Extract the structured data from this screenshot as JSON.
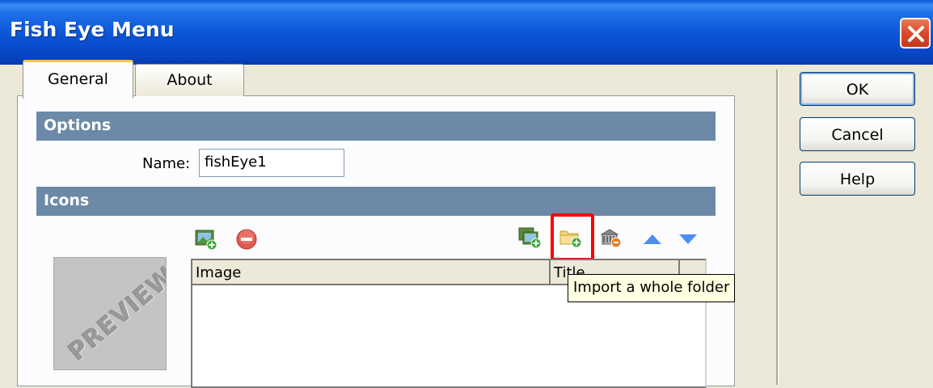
{
  "window": {
    "title": "Fish Eye Menu"
  },
  "tabs": [
    {
      "label": "General"
    },
    {
      "label": "About"
    }
  ],
  "options": {
    "header": "Options",
    "name_label": "Name:",
    "name_value": "fishEye1"
  },
  "icons": {
    "header": "Icons",
    "toolbar": [
      "add-image-icon",
      "remove-icon",
      "import-images-icon",
      "import-folder-icon",
      "browse-icon",
      "move-up-icon",
      "move-down-icon"
    ],
    "preview_text": "PREVIEW",
    "columns": [
      "Image",
      "Title"
    ],
    "tooltip": "Import a whole folder"
  },
  "buttons": {
    "ok": "OK",
    "cancel": "Cancel",
    "help": "Help"
  },
  "colors": {
    "title_bar": "#0b54d6",
    "section_header": "#6c8aa7",
    "highlight": "#ff0000",
    "tooltip_bg": "#ffffe1"
  }
}
